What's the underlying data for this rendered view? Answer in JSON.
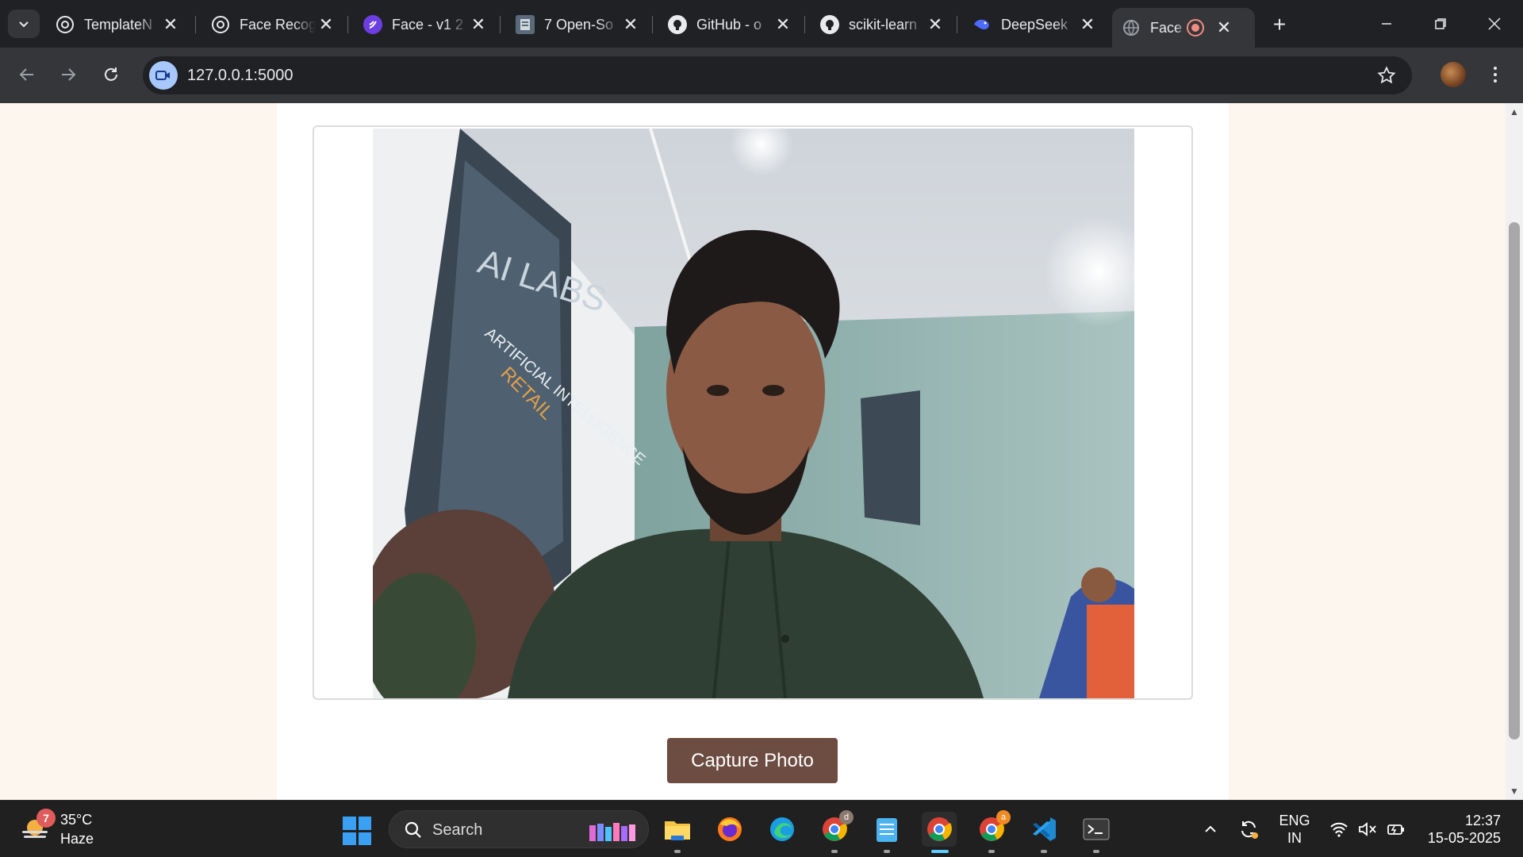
{
  "browser": {
    "tabs": [
      {
        "title": "TemplateN",
        "favicon": "openai-icon"
      },
      {
        "title": "Face Recog",
        "favicon": "openai-icon"
      },
      {
        "title": "Face - v1 2",
        "favicon": "app-icon"
      },
      {
        "title": "7 Open-So",
        "favicon": "doc-thumbnail-icon"
      },
      {
        "title": "GitHub - o",
        "favicon": "github-icon"
      },
      {
        "title": "scikit-learn",
        "favicon": "github-icon"
      },
      {
        "title": "DeepSeek",
        "favicon": "deepseek-icon"
      },
      {
        "title": "Face A",
        "favicon": "globe-icon",
        "active": true,
        "recording": true
      }
    ],
    "address_bar": {
      "url": "127.0.0.1:5000"
    },
    "colors": {
      "tab_bar": "#202124",
      "toolbar": "#35363a",
      "omnibox": "#202124"
    }
  },
  "page": {
    "capture_button": {
      "label": "Capture Photo",
      "color": "#6d4c41"
    },
    "webcam": {
      "live": true
    },
    "background_color": "#fdf6ef"
  },
  "taskbar": {
    "weather": {
      "temperature": "35°C",
      "condition": "Haze",
      "badge": "7"
    },
    "search": {
      "placeholder": "Search"
    },
    "apps": [
      "file-explorer-icon",
      "firefox-icon",
      "edge-icon",
      "chrome-icon",
      "notepad-icon",
      "chrome-icon",
      "chrome-icon",
      "vscode-icon",
      "terminal-icon"
    ],
    "app_badges": {
      "chrome_1": "d",
      "chrome_3": "a"
    },
    "language": {
      "line1": "ENG",
      "line2": "IN"
    },
    "clock": {
      "time": "12:37",
      "date": "15-05-2025"
    }
  }
}
